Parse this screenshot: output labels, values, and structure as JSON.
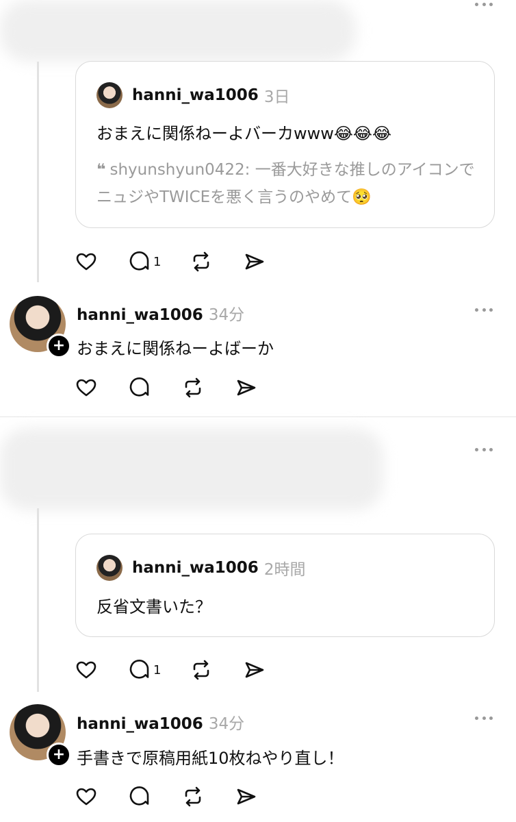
{
  "thread1": {
    "quote": {
      "username": "hanni_wa1006",
      "time": "3日",
      "text": "おまえに関係ねーよバーカwww😂😂😂",
      "quote_mark": "❝",
      "quoted_text": "shyunshyun0422: 一番大好きな推しのアイコンでニュジやTWICEを悪く言うのやめて🥺"
    },
    "reply_count": "1",
    "reply": {
      "username": "hanni_wa1006",
      "time": "34分",
      "text": "おまえに関係ねーよばーか"
    }
  },
  "thread2": {
    "quote": {
      "username": "hanni_wa1006",
      "time": "2時間",
      "text": "反省文書いた？"
    },
    "reply_count": "1",
    "reply": {
      "username": "hanni_wa1006",
      "time": "34分",
      "text": "手書きで原稿用紙10枚ねやり直し！"
    }
  },
  "icons": {
    "like": "heart-icon",
    "comment": "comment-icon",
    "repost": "repost-icon",
    "share": "share-icon",
    "more": "more-icon",
    "follow": "plus-icon"
  },
  "badge_plus": "+"
}
